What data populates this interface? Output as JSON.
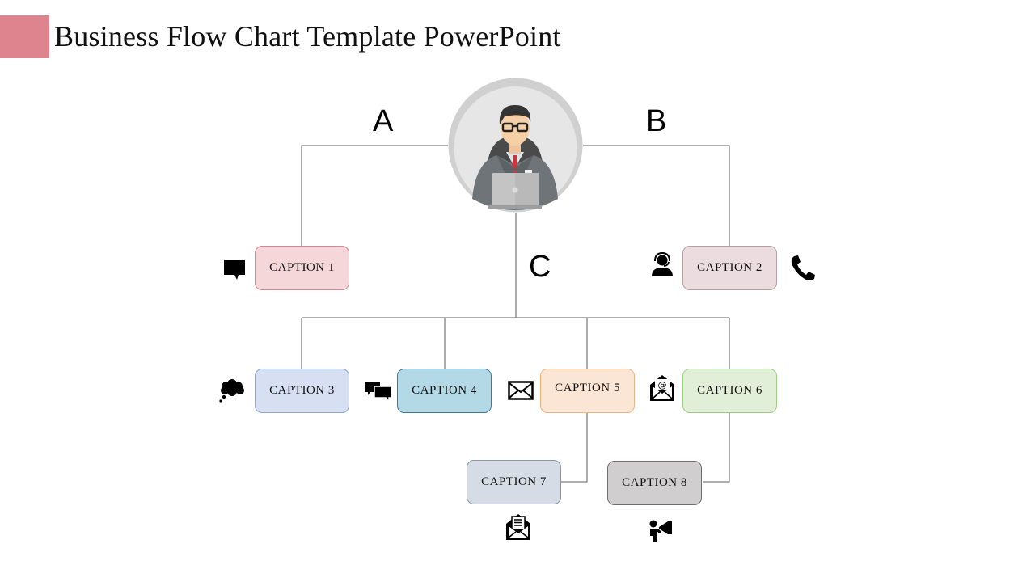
{
  "slide": {
    "title": "Business Flow Chart Template PowerPoint",
    "accent_color": "#de848e"
  },
  "center": {
    "icon": "businessman-laptop-icon"
  },
  "branch_labels": [
    "A",
    "B",
    "C"
  ],
  "captions": [
    {
      "label": "CAPTION 1",
      "fill": "#f5d7da",
      "border": "#d9888f",
      "icon": "speech-bubble-icon"
    },
    {
      "label": "CAPTION 2",
      "fill": "#ebdcdf",
      "border": "#b99ea3",
      "icon": "support-agent-icon",
      "icon2": "phone-icon"
    },
    {
      "label": "CAPTION 3",
      "fill": "#d6e0f2",
      "border": "#8fa8d4",
      "icon": "thought-cloud-icon"
    },
    {
      "label": "CAPTION 4",
      "fill": "#b3d8e6",
      "border": "#3e7a96",
      "icon": "chat-bubbles-icon"
    },
    {
      "label": "CAPTION 5",
      "fill": "#fbe5d4",
      "border": "#f0b27f",
      "icon": "envelope-icon"
    },
    {
      "label": "CAPTION 6",
      "fill": "#e1efd8",
      "border": "#9ccf85",
      "icon": "email-at-icon"
    },
    {
      "label": "CAPTION 7",
      "fill": "#d5dce6",
      "border": "#8596ae",
      "icon": "open-letter-icon"
    },
    {
      "label": "CAPTION 8",
      "fill": "#d0cece",
      "border": "#6f6f6f",
      "icon": "megaphone-person-icon"
    }
  ]
}
